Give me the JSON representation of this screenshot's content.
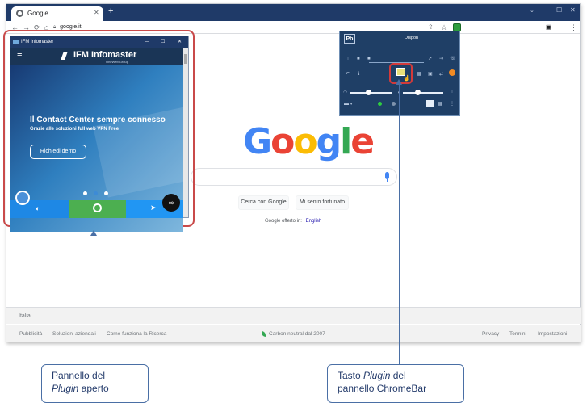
{
  "browser": {
    "tab_title": "Google",
    "new_tab": "+",
    "url": "google.it",
    "window_controls": {
      "minimize": "—",
      "maximize": "☐",
      "close": "✕"
    },
    "toolbar_icons": [
      "back-icon",
      "forward-icon",
      "reload-icon",
      "home-icon",
      "lock-icon",
      "share-icon",
      "star-icon",
      "chromebar-extension-icon",
      "sidepanel-icon",
      "menu-icon"
    ]
  },
  "google": {
    "logo_letters": [
      "G",
      "o",
      "o",
      "g",
      "l",
      "e"
    ],
    "logo_colors": [
      "#4285F4",
      "#EA4335",
      "#FBBC05",
      "#4285F4",
      "#34A853",
      "#EA4335"
    ],
    "search_button": "Cerca con Google",
    "lucky_button": "Mi sento fortunato",
    "offered_in": "Google offerto in:",
    "language_link": "English",
    "footer_country": "Italia",
    "footer_left": [
      "Pubblicità",
      "Soluzioni aziendali",
      "Come funziona la Ricerca"
    ],
    "footer_center": "Carbon neutral dal 2007",
    "footer_right": [
      "Privacy",
      "Termini",
      "Impostazioni"
    ]
  },
  "plugin_panel": {
    "window_title": "IFM Infomaster",
    "brand": "IFM Infomaster",
    "brand_sub": "OneWeb Group",
    "hero_title": "Il Contact Center sempre connesso",
    "hero_subtitle": "Grazie alle soluzioni full web VPN Free",
    "hero_button": "Richiedi demo",
    "carousel_dots": 3,
    "bottom_bar": [
      "messenger-icon",
      "whatsapp-icon",
      "telegram-icon"
    ],
    "bottom_colors": [
      "#1e88e5",
      "#4caf50",
      "#2196f3"
    ]
  },
  "chromebar": {
    "logo": "Pb",
    "status": "Dispon",
    "accent": "#e8e07a"
  },
  "callouts": {
    "left": {
      "line1": "Pannello del",
      "line2_italic": "Plugin",
      "line2_rest": " aperto"
    },
    "right": {
      "line1_a": "Tasto ",
      "line1_italic": "Plugin",
      "line1_b": " del",
      "line2": "pannello ChromeBar"
    }
  }
}
